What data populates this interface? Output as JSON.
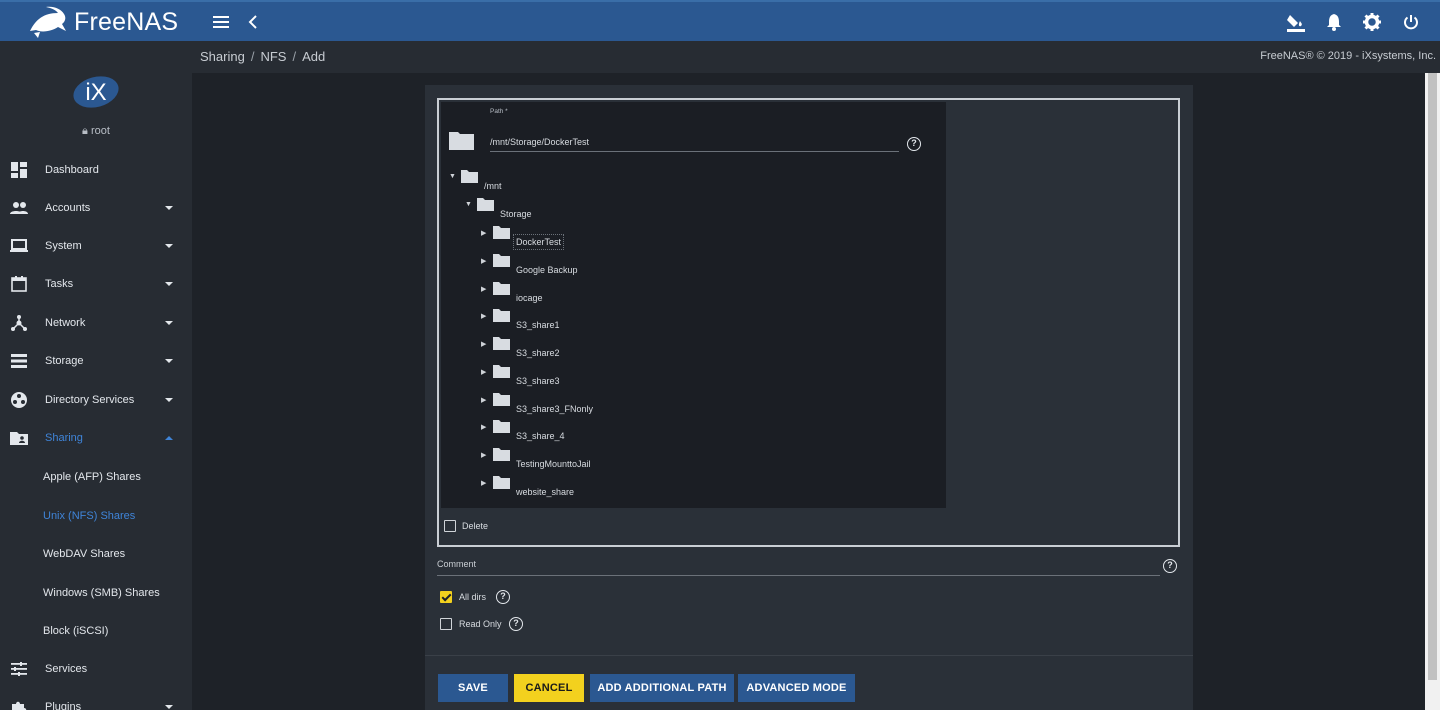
{
  "app": {
    "name": "FreeNAS",
    "copyright": "FreeNAS® © 2019 - iXsystems, Inc.",
    "user": "root",
    "avatar_text": "iX"
  },
  "topbar": {
    "icons": [
      "menu-icon",
      "back-icon",
      "theme-icon",
      "bell-icon",
      "gear-icon",
      "power-icon"
    ]
  },
  "breadcrumb": [
    "Sharing",
    "NFS",
    "Add"
  ],
  "sidebar": {
    "items": [
      {
        "label": "Dashboard",
        "icon": "dashboard-icon",
        "expandable": false
      },
      {
        "label": "Accounts",
        "icon": "people-icon",
        "expandable": true
      },
      {
        "label": "System",
        "icon": "laptop-icon",
        "expandable": true
      },
      {
        "label": "Tasks",
        "icon": "calendar-icon",
        "expandable": true
      },
      {
        "label": "Network",
        "icon": "network-icon",
        "expandable": true
      },
      {
        "label": "Storage",
        "icon": "storage-icon",
        "expandable": true
      },
      {
        "label": "Directory Services",
        "icon": "directory-icon",
        "expandable": true
      },
      {
        "label": "Sharing",
        "icon": "folder-shared-icon",
        "expandable": true,
        "active": true
      },
      {
        "label": "Services",
        "icon": "tune-icon",
        "expandable": false
      },
      {
        "label": "Plugins",
        "icon": "puzzle-icon",
        "expandable": true
      }
    ],
    "sharing_sub": [
      {
        "label": "Apple (AFP) Shares"
      },
      {
        "label": "Unix (NFS) Shares",
        "active": true
      },
      {
        "label": "WebDAV Shares"
      },
      {
        "label": "Windows (SMB) Shares"
      },
      {
        "label": "Block (iSCSI)"
      }
    ]
  },
  "form": {
    "path_label": "Path *",
    "path_value": "/mnt/Storage/DockerTest",
    "tree": {
      "root": "/mnt",
      "pool": "Storage",
      "children": [
        "DockerTest",
        "Google Backup",
        "iocage",
        "S3_share1",
        "S3_share2",
        "S3_share3",
        "S3_share3_FNonly",
        "S3_share_4",
        "TestingMounttoJail",
        "website_share"
      ]
    },
    "delete_label": "Delete",
    "comment_label": "Comment",
    "all_dirs_label": "All dirs",
    "all_dirs_checked": true,
    "read_only_label": "Read Only",
    "read_only_checked": false
  },
  "buttons": {
    "save": "SAVE",
    "cancel": "CANCEL",
    "add_path": "ADD ADDITIONAL PATH",
    "advanced": "ADVANCED MODE"
  },
  "colors": {
    "topbar": "#2b5891",
    "sidebar": "#272c33",
    "accent": "#3f84d8",
    "warn": "#f3d11e"
  }
}
